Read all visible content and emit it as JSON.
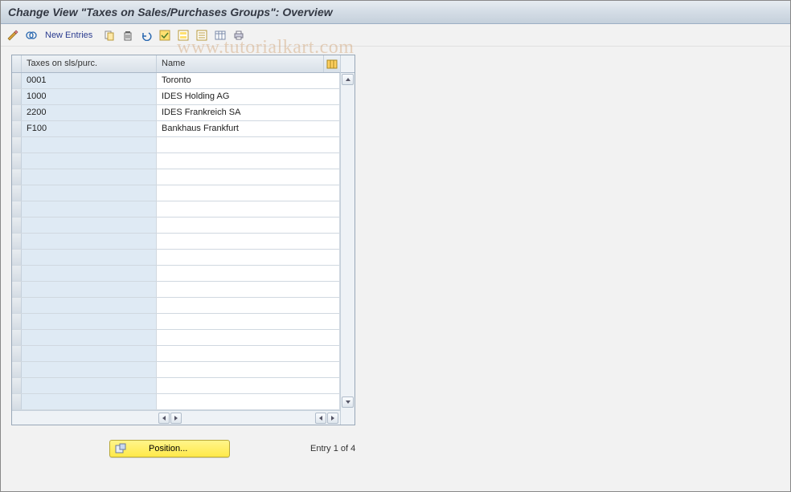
{
  "title": "Change View \"Taxes on Sales/Purchases Groups\": Overview",
  "toolbar": {
    "new_entries": "New Entries"
  },
  "grid": {
    "columns": {
      "code": "Taxes on sls/purc.",
      "name": "Name"
    },
    "rows": [
      {
        "code": "0001",
        "name": "Toronto"
      },
      {
        "code": "1000",
        "name": "IDES Holding AG"
      },
      {
        "code": "2200",
        "name": "IDES Frankreich SA"
      },
      {
        "code": "F100",
        "name": "Bankhaus Frankfurt"
      }
    ],
    "empty_rows": 17
  },
  "footer": {
    "position_label": "Position...",
    "entry_text": "Entry 1 of 4"
  },
  "watermark": "www.tutorialkart.com"
}
